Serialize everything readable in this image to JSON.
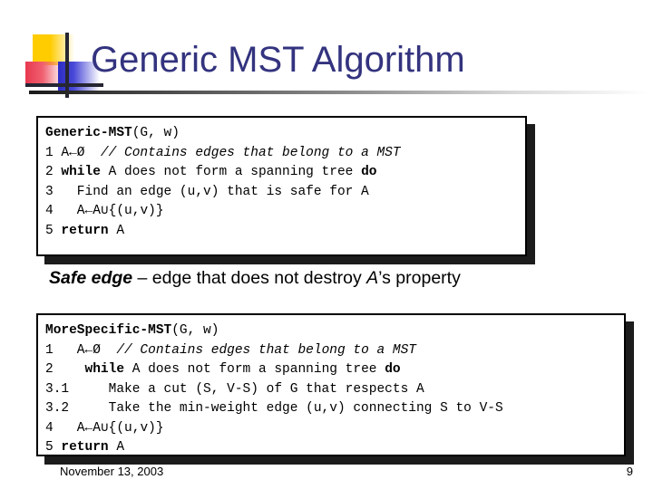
{
  "slide": {
    "title": "Generic MST Algorithm",
    "title_color": "#33337f"
  },
  "logo": {
    "yellow": "#ffcc00",
    "red": "#e8384f",
    "blue": "#2b2bc4",
    "bar": "#262633"
  },
  "code_box_generic": {
    "header_name": "Generic-MST",
    "header_args": "(G, w)",
    "lines": [
      {
        "num": "1",
        "pre": " A←Ø  ",
        "comment": "// Contains edges that belong to a MST"
      },
      {
        "num": "2",
        "kw1": "while",
        "mid": " A does not form a spanning tree ",
        "kw2": "do"
      },
      {
        "num": "3",
        "text": "   Find an edge (u,v) that is safe for A"
      },
      {
        "num": "4",
        "text": "   A←A∪{(u,v)}"
      },
      {
        "num": "5",
        "kw1": "return",
        "mid": " A"
      }
    ]
  },
  "safe_edge": {
    "term": "Safe edge",
    "dash": " – edge that does not destroy ",
    "var": "A",
    "tail": "’s property"
  },
  "code_box_specific": {
    "header_name": "MoreSpecific-MST",
    "header_args": "(G, w)",
    "lines": [
      {
        "num": "1",
        "pre": "   A←Ø  ",
        "comment": "// Contains edges that belong to a MST"
      },
      {
        "num": "2",
        "indent": "   ",
        "kw1": "while",
        "mid": " A does not form a spanning tree ",
        "kw2": "do"
      },
      {
        "num": "3.1",
        "text": "     Make a cut (S, V-S) of G that respects A"
      },
      {
        "num": "3.2",
        "text": "     Take the min-weight edge (u,v) connecting S to V-S"
      },
      {
        "num": "4",
        "text": "   A←A∪{(u,v)}"
      },
      {
        "num": "5",
        "kw1": "return",
        "mid": " A"
      }
    ]
  },
  "footer": {
    "date": "November 13, 2003",
    "page": "9"
  }
}
